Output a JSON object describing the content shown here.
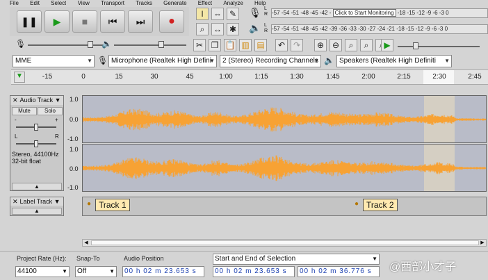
{
  "menu": [
    "File",
    "Edit",
    "Select",
    "View",
    "Transport",
    "Tracks",
    "Generate",
    "Effect",
    "Analyze",
    "Help"
  ],
  "transport": {
    "pause": "pause-icon",
    "play": "play-icon",
    "stop": "stop-icon",
    "skip_start": "skip-start-icon",
    "skip_end": "skip-end-icon",
    "record": "record-icon"
  },
  "meters": {
    "record_scale": "-57 -54 -51 -48 -45 -42 -",
    "monitor_text": "Click to Start Monitoring",
    "record_scale_tail": "-18 -15 -12 -9 -6 -3 0",
    "play_scale": "-57 -54 -51 -48 -45 -42 -39 -36 -33 -30 -27 -24 -21 -18 -15 -12 -9 -6 -3 0",
    "L": "L",
    "R": "R"
  },
  "devices": {
    "host": "MME",
    "input": "Microphone (Realtek High Defini",
    "channels": "2 (Stereo) Recording Channels",
    "output": "Speakers (Realtek High Definiti"
  },
  "ruler_ticks": [
    "-15",
    "0",
    "15",
    "30",
    "45",
    "1:00",
    "1:15",
    "1:30",
    "1:45",
    "2:00",
    "2:15",
    "2:30",
    "2:45"
  ],
  "audio_track": {
    "name": "Audio Track",
    "mute": "Mute",
    "solo": "Solo",
    "gain_minus": "-",
    "gain_plus": "+",
    "pan_left": "L",
    "pan_right": "R",
    "info1": "Stereo, 44100Hz",
    "info2": "32-bit float",
    "scale_top": "1.0",
    "scale_mid": "0.0",
    "scale_bot": "-1.0"
  },
  "label_track": {
    "name": "Label Track",
    "labels": [
      "Track 1",
      "Track 2"
    ]
  },
  "bottom": {
    "project_rate_label": "Project Rate (Hz):",
    "project_rate": "44100",
    "snap_label": "Snap-To",
    "snap_value": "Off",
    "audio_pos_label": "Audio Position",
    "audio_pos": "00 h 02 m 23.653 s",
    "selection_mode": "Start and End of Selection",
    "sel_start": "00 h 02 m 23.653 s",
    "sel_end": "00 h 02 m 36.776 s"
  },
  "watermark": "@西部小才子",
  "colors": {
    "waveform": "#f7a234",
    "selection": "#d9d2c2",
    "accent_record": "#d22222"
  }
}
